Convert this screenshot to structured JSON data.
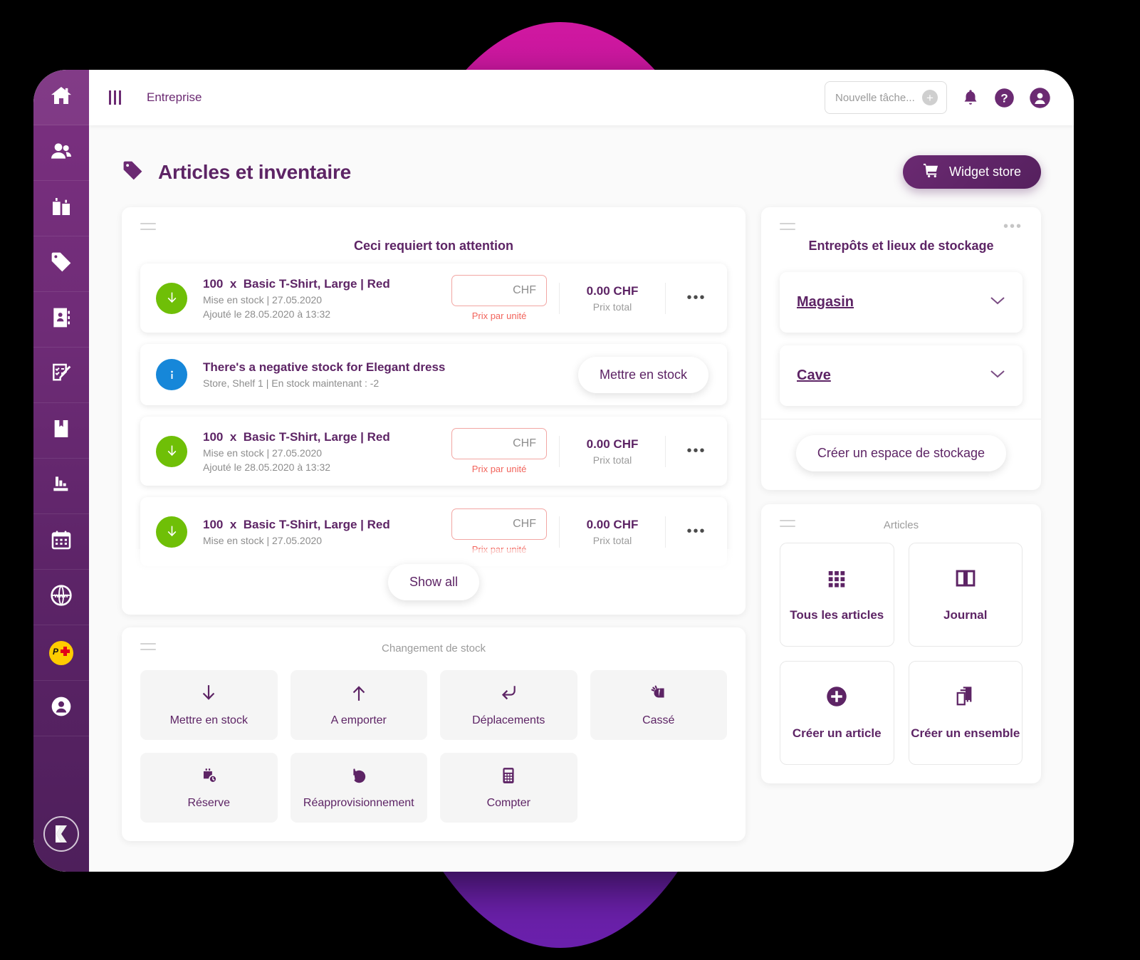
{
  "sidebar": {
    "items": [
      {
        "name": "home",
        "icon": "home-icon"
      },
      {
        "name": "contacts",
        "icon": "users-icon"
      },
      {
        "name": "companies",
        "icon": "buildings-icon"
      },
      {
        "name": "articles",
        "icon": "tag-icon"
      },
      {
        "name": "address-book",
        "icon": "address-book-icon"
      },
      {
        "name": "tasks",
        "icon": "clipboard-edit-icon"
      },
      {
        "name": "documents",
        "icon": "book-bookmark-icon"
      },
      {
        "name": "reports",
        "icon": "chart-icon"
      },
      {
        "name": "calendar",
        "icon": "calendar-icon"
      },
      {
        "name": "website",
        "icon": "www-globe-icon"
      },
      {
        "name": "swiss-post",
        "icon": "swiss-post-icon"
      },
      {
        "name": "profile",
        "icon": "user-circle-icon"
      }
    ],
    "logo": "klara-logo-icon"
  },
  "topbar": {
    "menu_icon": "hamburger-icon",
    "breadcrumb": "Entreprise",
    "task_placeholder": "Nouvelle tâche...",
    "add_icon": "plus-circle-icon",
    "bell_icon": "bell-icon",
    "help_icon": "question-circle-icon",
    "avatar_icon": "user-avatar-icon"
  },
  "page": {
    "title": "Articles et inventaire",
    "title_icon": "tag-icon",
    "widget_store_label": "Widget store",
    "widget_store_icon": "cart-icon"
  },
  "attention": {
    "title": "Ceci requiert ton attention",
    "show_all_label": "Show all",
    "rows": [
      {
        "type": "stock-in",
        "icon": "arrow-down-icon",
        "badge_color": "#6fbf07",
        "qty": "100",
        "multiplier": "x",
        "product": "Basic T-Shirt, Large | Red",
        "sub1": "Mise en stock | 27.05.2020",
        "sub2": "Ajouté le 28.05.2020 à 13:32",
        "price_value": "CHF",
        "price_label": "Prix par unité",
        "total_value": "0.00 CHF",
        "total_label": "Prix total",
        "menu": "•••"
      },
      {
        "type": "negative-stock",
        "icon": "info-icon",
        "badge_color": "#1687d9",
        "title": "There's a negative stock for Elegant dress",
        "sub1": "Store, Shelf 1 | En stock maintenant : -2",
        "action_label": "Mettre en stock"
      },
      {
        "type": "stock-in",
        "icon": "arrow-down-icon",
        "badge_color": "#6fbf07",
        "qty": "100",
        "multiplier": "x",
        "product": "Basic T-Shirt, Large | Red",
        "sub1": "Mise en stock | 27.05.2020",
        "sub2": "Ajouté le 28.05.2020 à 13:32",
        "price_value": "CHF",
        "price_label": "Prix par unité",
        "total_value": "0.00 CHF",
        "total_label": "Prix total",
        "menu": "•••"
      },
      {
        "type": "stock-in",
        "icon": "arrow-down-icon",
        "badge_color": "#6fbf07",
        "qty": "100",
        "multiplier": "x",
        "product": "Basic T-Shirt, Large | Red",
        "sub1": "Mise en stock | 27.05.2020",
        "sub2": "",
        "price_value": "CHF",
        "price_label": "Prix par unité",
        "total_value": "0.00 CHF",
        "total_label": "Prix total",
        "menu": "•••"
      }
    ]
  },
  "stock_change": {
    "title": "Changement de stock",
    "tiles": [
      {
        "label": "Mettre en stock",
        "icon": "arrow-down-icon"
      },
      {
        "label": "A emporter",
        "icon": "arrow-up-icon"
      },
      {
        "label": "Déplacements",
        "icon": "arrow-return-icon"
      },
      {
        "label": "Cassé",
        "icon": "broken-icon"
      },
      {
        "label": "Réserve",
        "icon": "reserve-clock-icon"
      },
      {
        "label": "Réapprovisionnement",
        "icon": "rotate-ccw-icon"
      },
      {
        "label": "Compter",
        "icon": "calculator-icon"
      }
    ]
  },
  "warehouses": {
    "title": "Entrepôts et lieux de stockage",
    "menu": "•••",
    "items": [
      {
        "name": "Magasin",
        "chevron": "chevron-down-icon"
      },
      {
        "name": "Cave",
        "chevron": "chevron-down-icon"
      }
    ],
    "create_label": "Créer un espace de stockage"
  },
  "articles": {
    "title": "Articles",
    "tiles": [
      {
        "label": "Tous les articles",
        "icon": "grid-icon"
      },
      {
        "label": "Journal",
        "icon": "book-open-icon"
      },
      {
        "label": "Créer un article",
        "icon": "plus-circle-filled-icon"
      },
      {
        "label": "Créer un ensemble",
        "icon": "copy-stack-icon"
      }
    ]
  },
  "colors": {
    "brand_purple": "#5d2465",
    "accent_magenta": "#cf18a0",
    "accent_violet": "#6a20ab",
    "green": "#6fbf07",
    "blue": "#1687d9",
    "red": "#f2645c"
  }
}
